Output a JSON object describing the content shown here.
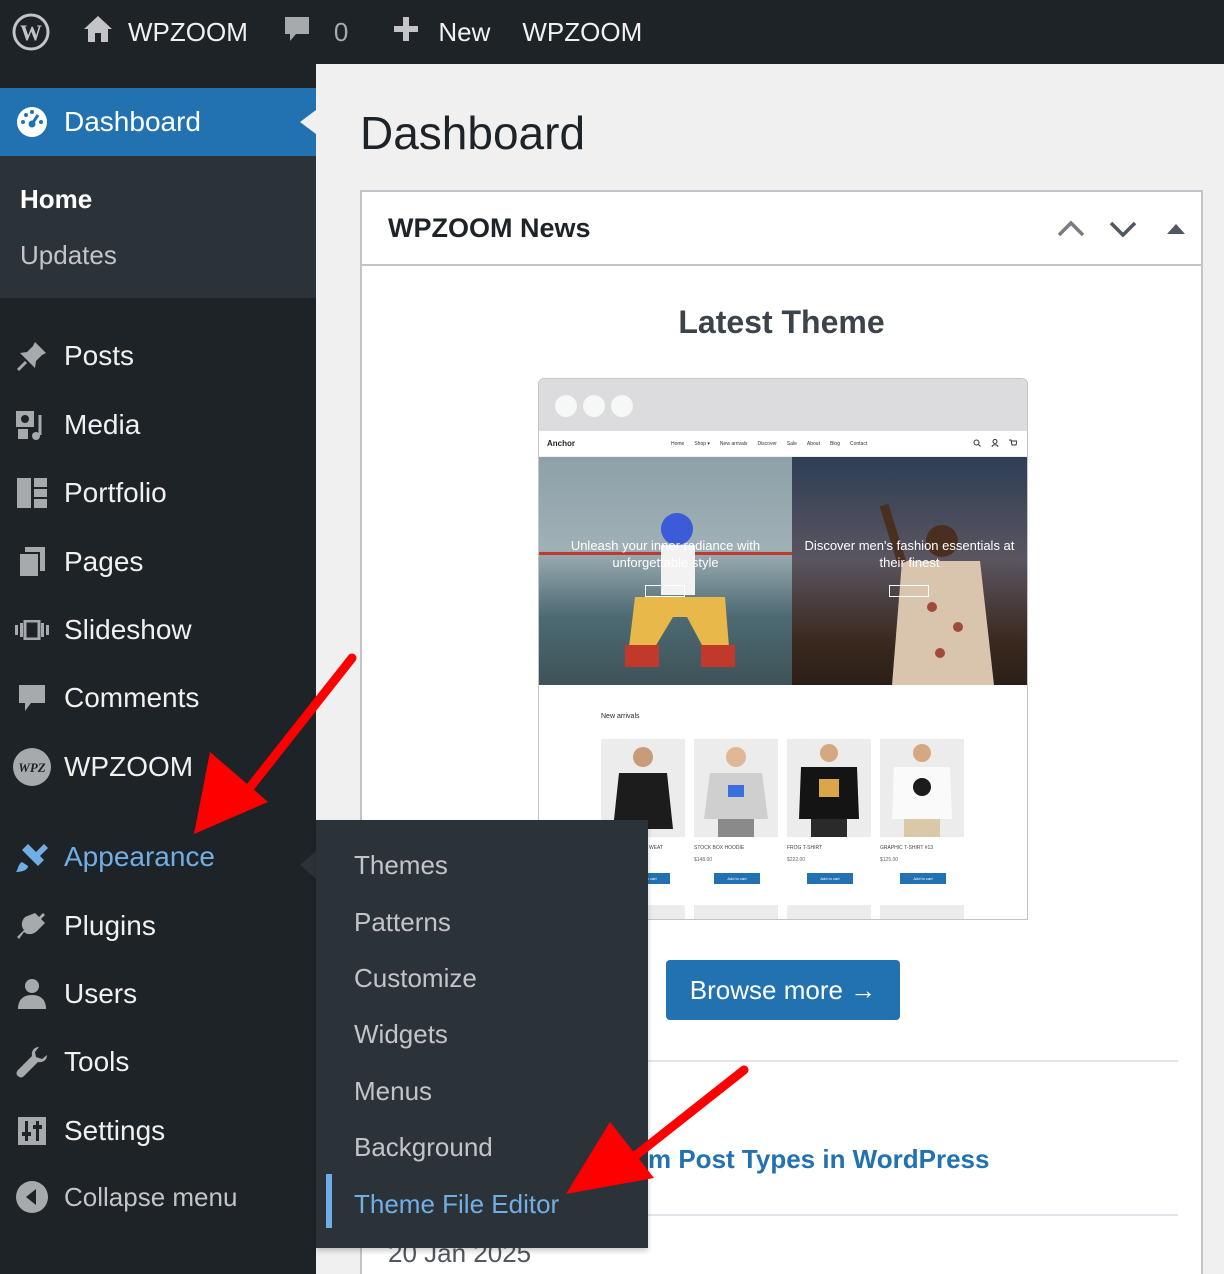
{
  "adminbar": {
    "wp_icon": "wordpress-logo-icon",
    "site_name": "WPZOOM",
    "comments_count": "0",
    "new_label": "New",
    "plugin_label": "WPZOOM"
  },
  "sidebar": {
    "dashboard_label": "Dashboard",
    "dashboard_sub": [
      "Home",
      "Updates"
    ],
    "items": [
      {
        "label": "Posts",
        "icon": "pushpin-icon"
      },
      {
        "label": "Media",
        "icon": "media-icon"
      },
      {
        "label": "Portfolio",
        "icon": "portfolio-icon"
      },
      {
        "label": "Pages",
        "icon": "pages-icon"
      },
      {
        "label": "Slideshow",
        "icon": "slideshow-icon"
      },
      {
        "label": "Comments",
        "icon": "comment-icon"
      },
      {
        "label": "WPZOOM",
        "icon": "wpz-logo-icon"
      },
      {
        "label": "Appearance",
        "icon": "paintbrush-icon"
      },
      {
        "label": "Plugins",
        "icon": "plugin-icon"
      },
      {
        "label": "Users",
        "icon": "user-icon"
      },
      {
        "label": "Tools",
        "icon": "wrench-icon"
      },
      {
        "label": "Settings",
        "icon": "settings-icon"
      }
    ],
    "collapse_label": "Collapse menu"
  },
  "flyout": {
    "items": [
      "Themes",
      "Patterns",
      "Customize",
      "Widgets",
      "Menus",
      "Background",
      "Theme File Editor"
    ]
  },
  "main": {
    "page_title": "Dashboard",
    "widget_title": "WPZOOM News",
    "latest_theme_heading": "Latest Theme",
    "browse_label": "Browse more →",
    "news_link": "m Post Types in WordPress",
    "news_date": "20 Jan 2025"
  },
  "preview": {
    "site_logo": "Anchor",
    "nav": [
      "Home",
      "Shop ▾",
      "New arrivals",
      "Discover",
      "Sale",
      "About",
      "Blog",
      "Contact"
    ],
    "hero_left": "Unleash your inner radiance with unforgettable style",
    "hero_right": "Discover men's fashion essentials at their finest",
    "new_arrivals": "New arrivals",
    "products": [
      {
        "name": "WEAT",
        "price": ""
      },
      {
        "name": "STOCK BOX HOODIE",
        "price": "$148.00"
      },
      {
        "name": "FROG T-SHIRT",
        "price": "$222.00"
      },
      {
        "name": "GRAPHIC T-SHIRT #13",
        "price": "$125.00"
      }
    ],
    "add_to_cart": "Add to cart"
  },
  "colors": {
    "adminbar_bg": "#1d2327",
    "accent": "#2271b1",
    "hover_blue": "#72aee6",
    "annotation_red": "#ff0000"
  }
}
